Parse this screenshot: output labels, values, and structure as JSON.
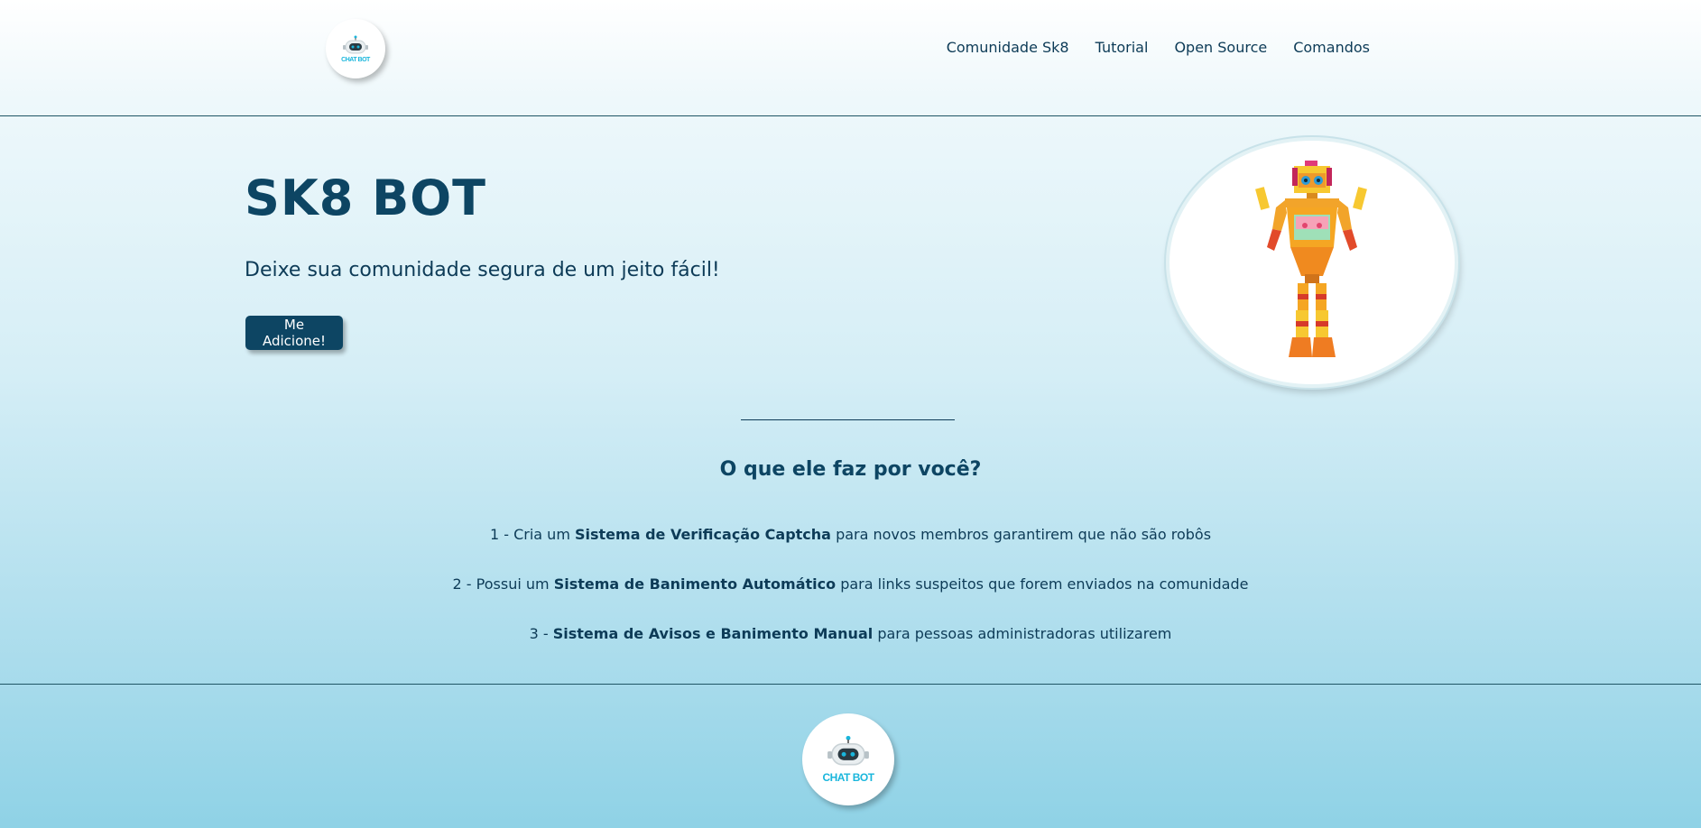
{
  "header": {
    "logo_text": "CHAT BOT",
    "nav": [
      {
        "label": "Comunidade Sk8"
      },
      {
        "label": "Tutorial"
      },
      {
        "label": "Open Source"
      },
      {
        "label": "Comandos"
      }
    ]
  },
  "hero": {
    "title": "SK8 BOT",
    "subtitle": "Deixe sua comunidade segura de um jeito fácil!",
    "cta_label": "Me Adicione!"
  },
  "features": {
    "title": "O que ele faz por você?",
    "items": [
      {
        "prefix": "1 - Cria um ",
        "bold": "Sistema de Verificação Captcha",
        "suffix": " para novos membros garantirem que não são robôs"
      },
      {
        "prefix": "2 - Possui um ",
        "bold": "Sistema de Banimento Automático",
        "suffix": " para links suspeitos que forem enviados na comunidade"
      },
      {
        "prefix": "3 - ",
        "bold": "Sistema de Avisos e Banimento Manual",
        "suffix": " para pessoas administradoras utilizarem"
      }
    ]
  },
  "footer": {
    "logo_text": "CHAT BOT"
  },
  "colors": {
    "primary": "#0d4563",
    "accent": "#19b6dc",
    "text": "#0d3b57"
  }
}
